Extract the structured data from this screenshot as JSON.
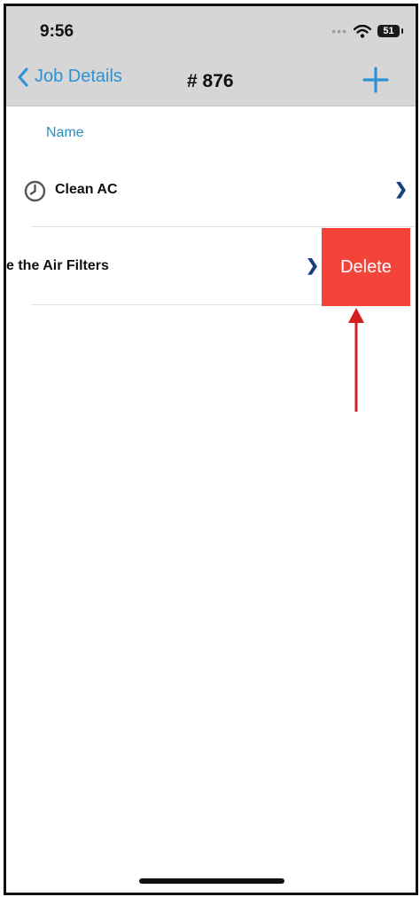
{
  "status_bar": {
    "time": "9:56",
    "signal": "•••",
    "battery": "51"
  },
  "nav": {
    "back_label": "Job Details",
    "title": "# 876"
  },
  "list": {
    "column_header": "Name",
    "items": [
      {
        "label": "Clean AC",
        "icon": "clock-icon"
      },
      {
        "label": "e the Air Filters"
      }
    ],
    "delete_label": "Delete"
  },
  "colors": {
    "accent": "#2b93d6",
    "delete": "#f4443a",
    "annotation_arrow": "#d42020"
  }
}
